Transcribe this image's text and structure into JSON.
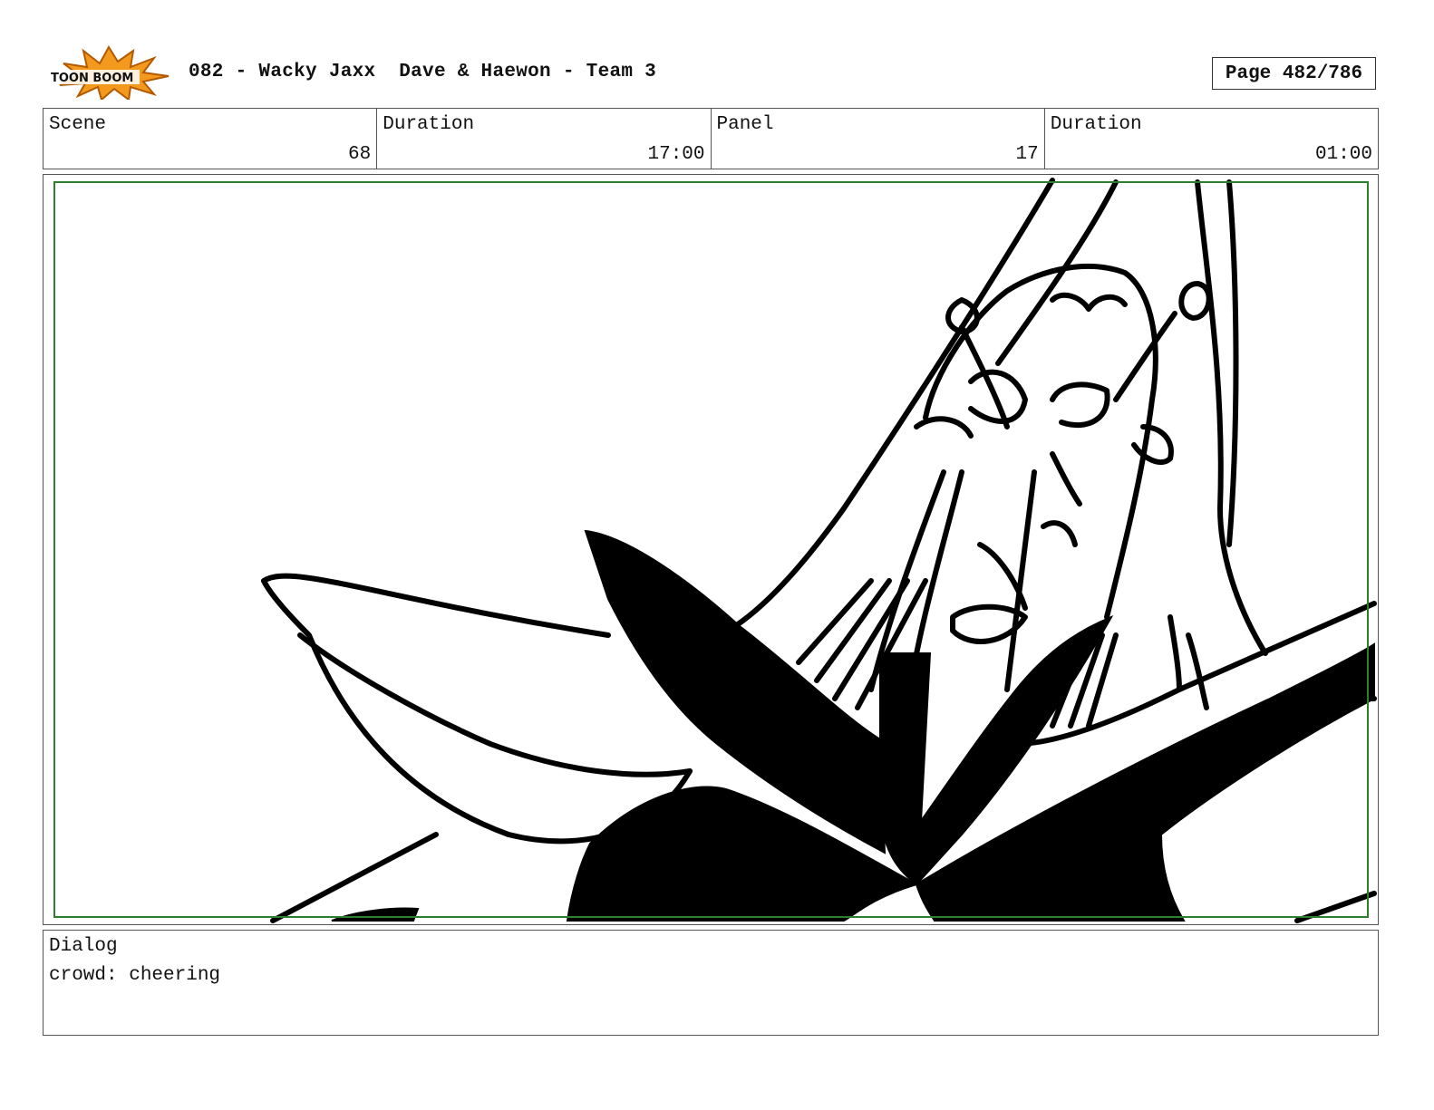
{
  "header": {
    "logo_text": "TOON BOOM",
    "title": "082 - Wacky Jaxx  Dave & Haewon - Team 3",
    "page": "Page 482/786"
  },
  "info": {
    "scene_label": "Scene",
    "scene_value": "68",
    "scene_duration_label": "Duration",
    "scene_duration_value": "17:00",
    "panel_label": "Panel",
    "panel_value": "17",
    "panel_duration_label": "Duration",
    "panel_duration_value": "01:00"
  },
  "dialog": {
    "label": "Dialog",
    "text": "crowd: cheering"
  },
  "colors": {
    "safe_frame": "#2f7d2f",
    "logo_orange": "#f39a1e"
  }
}
